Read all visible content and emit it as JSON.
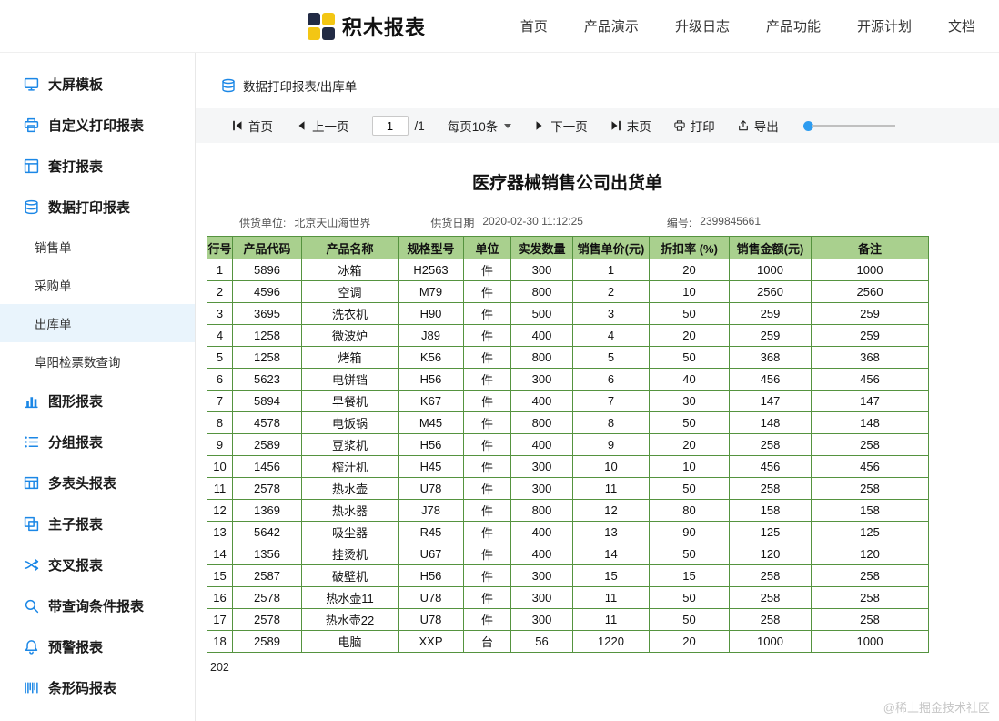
{
  "header": {
    "logo_text": "积木报表",
    "nav": [
      {
        "label": "首页"
      },
      {
        "label": "产品演示"
      },
      {
        "label": "升级日志"
      },
      {
        "label": "产品功能"
      },
      {
        "label": "开源计划"
      },
      {
        "label": "文档"
      }
    ]
  },
  "sidebar": {
    "items": [
      {
        "key": "big-screen-template",
        "label": "大屏模板",
        "icon": "screen-icon"
      },
      {
        "key": "custom-print-report",
        "label": "自定义打印报表",
        "icon": "custom-print-icon"
      },
      {
        "key": "template-print-report",
        "label": "套打报表",
        "icon": "template-print-icon"
      },
      {
        "key": "data-print-report",
        "label": "数据打印报表",
        "icon": "database-icon"
      },
      {
        "key": "sales-order",
        "label": "销售单",
        "sub": true
      },
      {
        "key": "purchase-order",
        "label": "采购单",
        "sub": true
      },
      {
        "key": "outbound-order",
        "label": "出库单",
        "sub": true,
        "active": true
      },
      {
        "key": "fuyang-ticket-query",
        "label": "阜阳检票数查询",
        "sub": true
      },
      {
        "key": "chart-report",
        "label": "图形报表",
        "icon": "bar-chart-icon"
      },
      {
        "key": "group-report",
        "label": "分组报表",
        "icon": "group-list-icon"
      },
      {
        "key": "multi-header-report",
        "label": "多表头报表",
        "icon": "multi-header-icon"
      },
      {
        "key": "main-sub-report",
        "label": "主子报表",
        "icon": "main-sub-icon"
      },
      {
        "key": "cross-report",
        "label": "交叉报表",
        "icon": "cross-icon"
      },
      {
        "key": "query-condition-report",
        "label": "带查询条件报表",
        "icon": "search-icon"
      },
      {
        "key": "warning-report",
        "label": "预警报表",
        "icon": "alert-icon"
      },
      {
        "key": "barcode-report",
        "label": "条形码报表",
        "icon": "barcode-icon"
      }
    ]
  },
  "breadcrumb": {
    "text": "数据打印报表/出库单"
  },
  "toolbar": {
    "first_label": "首页",
    "prev_label": "上一页",
    "page_value": "1",
    "page_total": "/1",
    "page_size_label": "每页10条",
    "next_label": "下一页",
    "last_label": "末页",
    "print_label": "打印",
    "export_label": "导出"
  },
  "report": {
    "title": "医疗器械销售公司出货单",
    "supplier_label": "供货单位:",
    "supplier_value": "北京天山海世界",
    "date_label": "供货日期",
    "date_value": "2020-02-30 11:12:25",
    "number_label": "编号:",
    "number_value": "2399845661"
  },
  "table": {
    "headers": [
      "行号",
      "产品代码",
      "产品名称",
      "规格型号",
      "单位",
      "实发数量",
      "销售单价(元)",
      "折扣率 (%)",
      "销售金额(元)",
      "备注"
    ],
    "rows": [
      [
        "1",
        "5896",
        "冰箱",
        "H2563",
        "件",
        "300",
        "1",
        "20",
        "1000",
        "1000"
      ],
      [
        "2",
        "4596",
        "空调",
        "M79",
        "件",
        "800",
        "2",
        "10",
        "2560",
        "2560"
      ],
      [
        "3",
        "3695",
        "洗衣机",
        "H90",
        "件",
        "500",
        "3",
        "50",
        "259",
        "259"
      ],
      [
        "4",
        "1258",
        "微波炉",
        "J89",
        "件",
        "400",
        "4",
        "20",
        "259",
        "259"
      ],
      [
        "5",
        "1258",
        "烤箱",
        "K56",
        "件",
        "800",
        "5",
        "50",
        "368",
        "368"
      ],
      [
        "6",
        "5623",
        "电饼铛",
        "H56",
        "件",
        "300",
        "6",
        "40",
        "456",
        "456"
      ],
      [
        "7",
        "5894",
        "早餐机",
        "K67",
        "件",
        "400",
        "7",
        "30",
        "147",
        "147"
      ],
      [
        "8",
        "4578",
        "电饭锅",
        "M45",
        "件",
        "800",
        "8",
        "50",
        "148",
        "148"
      ],
      [
        "9",
        "2589",
        "豆浆机",
        "H56",
        "件",
        "400",
        "9",
        "20",
        "258",
        "258"
      ],
      [
        "10",
        "1456",
        "榨汁机",
        "H45",
        "件",
        "300",
        "10",
        "10",
        "456",
        "456"
      ],
      [
        "11",
        "2578",
        "热水壶",
        "U78",
        "件",
        "300",
        "11",
        "50",
        "258",
        "258"
      ],
      [
        "12",
        "1369",
        "热水器",
        "J78",
        "件",
        "800",
        "12",
        "80",
        "158",
        "158"
      ],
      [
        "13",
        "5642",
        "吸尘器",
        "R45",
        "件",
        "400",
        "13",
        "90",
        "125",
        "125"
      ],
      [
        "14",
        "1356",
        "挂烫机",
        "U67",
        "件",
        "400",
        "14",
        "50",
        "120",
        "120"
      ],
      [
        "15",
        "2587",
        "破壁机",
        "H56",
        "件",
        "300",
        "15",
        "15",
        "258",
        "258"
      ],
      [
        "16",
        "2578",
        "热水壶11",
        "U78",
        "件",
        "300",
        "11",
        "50",
        "258",
        "258"
      ],
      [
        "17",
        "2578",
        "热水壶22",
        "U78",
        "件",
        "300",
        "11",
        "50",
        "258",
        "258"
      ],
      [
        "18",
        "2589",
        "电脑",
        "XXP",
        "台",
        "56",
        "1220",
        "20",
        "1000",
        "1000"
      ]
    ]
  },
  "footer": {
    "count": "202",
    "watermark": "@稀土掘金技术社区"
  },
  "colors": {
    "accent_blue": "#1b87e6",
    "table_header_bg": "#a9d08e",
    "table_border": "#55933f",
    "toolbar_bg": "#f5f6f7",
    "active_item_bg": "#e9f4fc"
  }
}
